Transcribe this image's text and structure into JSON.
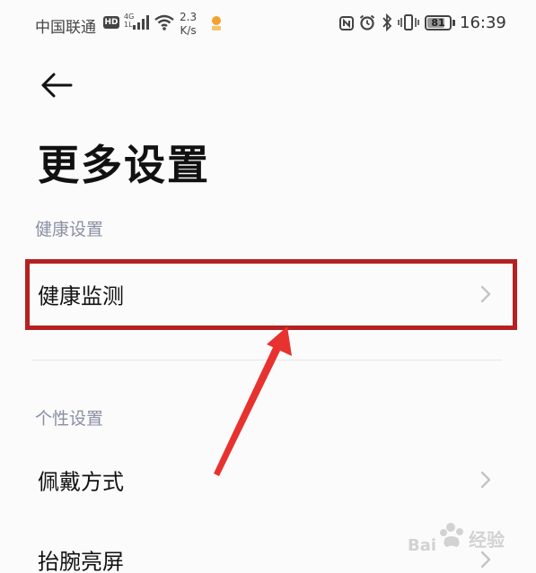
{
  "status_bar": {
    "carrier": "中国联通",
    "hd_badge": "HD",
    "network_type": "4G",
    "network_sub": "1L",
    "speed_value": "2.3",
    "speed_unit": "K/s",
    "battery_level": "81",
    "battery_fraction": 0.81,
    "time": "16:39",
    "icons": [
      "signal-icon",
      "wifi-icon",
      "app-notification-icon",
      "nfc-icon",
      "alarm-icon",
      "bluetooth-icon",
      "vibrate-icon",
      "battery-icon"
    ]
  },
  "header": {
    "back_icon": "back-arrow-icon",
    "title": "更多设置"
  },
  "sections": [
    {
      "header": "健康设置",
      "items": [
        {
          "label": "健康监测",
          "icon": "chevron-right-icon"
        }
      ]
    },
    {
      "header": "个性设置",
      "items": [
        {
          "label": "佩戴方式",
          "icon": "chevron-right-icon"
        },
        {
          "label": "抬腕亮屏",
          "icon": "chevron-right-icon"
        }
      ]
    }
  ],
  "annotations": {
    "highlight_color": "#b52121",
    "arrow_color": "#e8322f"
  },
  "watermark": {
    "text": "经验",
    "logo": "baidu-logo"
  },
  "colors": {
    "background": "#fbfbfb",
    "section_header": "#8a8fa3",
    "chevron": "#c4c4c4",
    "divider": "#e6e6e6"
  }
}
